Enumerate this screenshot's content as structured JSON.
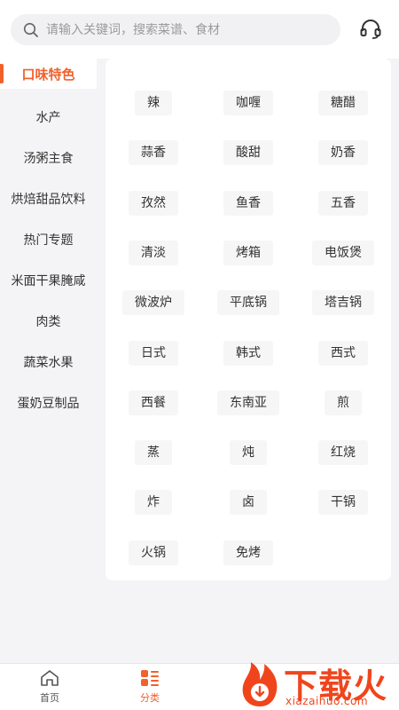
{
  "search": {
    "placeholder": "请输入关键词，搜索菜谱、食材",
    "value": ""
  },
  "header": {
    "headset_icon": "headset-icon"
  },
  "sidebar": {
    "items": [
      {
        "label": "口味特色",
        "active": true
      },
      {
        "label": "水产"
      },
      {
        "label": "汤粥主食"
      },
      {
        "label": "烘焙甜品饮料"
      },
      {
        "label": "热门专题"
      },
      {
        "label": "米面干果腌咸"
      },
      {
        "label": "肉类"
      },
      {
        "label": "蔬菜水果"
      },
      {
        "label": "蛋奶豆制品"
      }
    ]
  },
  "tags": [
    "辣",
    "咖喱",
    "糖醋",
    "蒜香",
    "酸甜",
    "奶香",
    "孜然",
    "鱼香",
    "五香",
    "清淡",
    "烤箱",
    "电饭煲",
    "微波炉",
    "平底锅",
    "塔吉锅",
    "日式",
    "韩式",
    "西式",
    "西餐",
    "东南亚",
    "煎",
    "蒸",
    "炖",
    "红烧",
    "炸",
    "卤",
    "干锅",
    "火锅",
    "免烤"
  ],
  "tabbar": {
    "items": [
      {
        "label": "首页",
        "icon": "home-icon"
      },
      {
        "label": "分类",
        "icon": "category-icon",
        "active": true
      }
    ]
  },
  "watermark": {
    "brand": "下载火",
    "url": "xiazaihuo.com"
  },
  "colors": {
    "accent": "#f2602c",
    "watermark": "#f0451c"
  }
}
